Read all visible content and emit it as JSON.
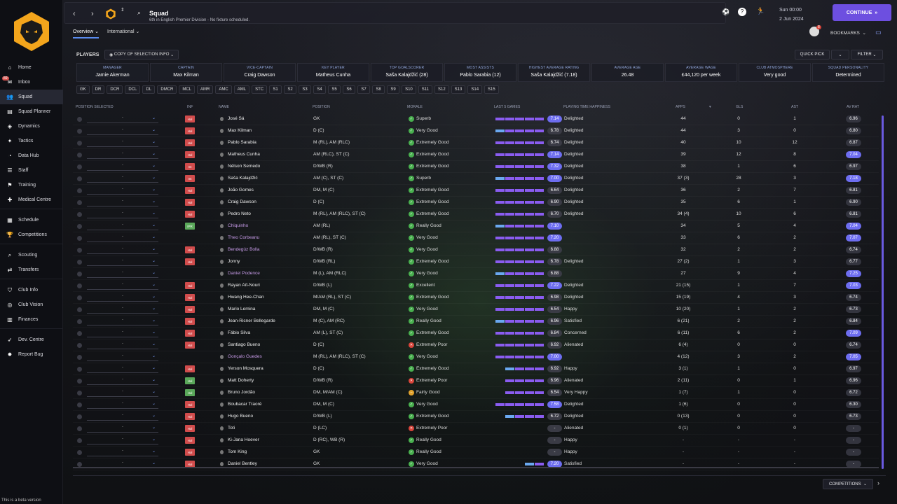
{
  "sidebar": {
    "items": [
      {
        "label": "Home",
        "icon": "home-icon"
      },
      {
        "label": "Inbox",
        "icon": "inbox-icon",
        "badge": "89"
      },
      {
        "label": "Squad",
        "icon": "squad-icon",
        "active": true
      },
      {
        "label": "Squad Planner",
        "icon": "planner-icon"
      },
      {
        "label": "Dynamics",
        "icon": "dynamics-icon"
      },
      {
        "label": "Tactics",
        "icon": "tactics-icon"
      },
      {
        "label": "Data Hub",
        "icon": "datahub-icon"
      },
      {
        "label": "Staff",
        "icon": "staff-icon"
      },
      {
        "label": "Training",
        "icon": "training-icon"
      },
      {
        "label": "Medical Centre",
        "icon": "medical-icon"
      },
      {
        "label": "Schedule",
        "icon": "schedule-icon"
      },
      {
        "label": "Competitions",
        "icon": "trophy-icon"
      },
      {
        "label": "Scouting",
        "icon": "scouting-icon"
      },
      {
        "label": "Transfers",
        "icon": "transfers-icon"
      },
      {
        "label": "Club Info",
        "icon": "club-info-icon"
      },
      {
        "label": "Club Vision",
        "icon": "club-vision-icon"
      },
      {
        "label": "Finances",
        "icon": "finances-icon"
      },
      {
        "label": "Dev. Centre",
        "icon": "dev-centre-icon"
      },
      {
        "label": "Report Bug",
        "icon": "report-bug-icon"
      }
    ],
    "beta_text": "This is a beta version"
  },
  "header": {
    "title": "Squad",
    "subtitle": "6th in English Premier Division - No fixture scheduled.",
    "time": "Sun 00:00",
    "date": "2 Jun 2024",
    "continue_label": "CONTINUE",
    "tabs": [
      "Overview",
      "International"
    ],
    "bookmarks_label": "BOOKMARKS",
    "notif_count": "8"
  },
  "toolbar": {
    "players_label": "PLAYERS",
    "copy_selection": "COPY OF SELECTION INFO",
    "quick_pick": "QUICK PICK",
    "filter": "FILTER"
  },
  "stats": [
    {
      "label": "MANAGER",
      "value": "Jamie Akerman"
    },
    {
      "label": "CAPTAIN",
      "value": "Max Kilman"
    },
    {
      "label": "VICE-CAPTAIN",
      "value": "Craig Dawson"
    },
    {
      "label": "KEY PLAYER",
      "value": "Matheus Cunha"
    },
    {
      "label": "TOP GOALSCORER",
      "value": "Saša Kalajdžić (28)"
    },
    {
      "label": "MOST ASSISTS",
      "value": "Pablo Sarabia (12)"
    },
    {
      "label": "HIGHEST AVERAGE RATING",
      "value": "Saša Kalajdžić (7.18)"
    },
    {
      "label": "AVERAGE AGE",
      "value": "26.48"
    },
    {
      "label": "AVERAGE WAGE",
      "value": "£44,120 per week"
    },
    {
      "label": "CLUB ATMOSPHERE",
      "value": "Very good"
    },
    {
      "label": "SQUAD PERSONALITY",
      "value": "Determined"
    }
  ],
  "position_filters": [
    "GK",
    "DR",
    "DCR",
    "DCL",
    "DL",
    "DMCR",
    "MCL",
    "AMR",
    "AMC",
    "AML",
    "STC",
    "S1",
    "S2",
    "S3",
    "S4",
    "S5",
    "S6",
    "S7",
    "S8",
    "S9",
    "S10",
    "S11",
    "S12",
    "S13",
    "S14",
    "S15"
  ],
  "columns": {
    "pos_selected": "POSITION SELECTED",
    "inf": "INF",
    "name": "NAME",
    "position": "POSITION",
    "morale": "MORALE",
    "last5": "LAST 5 GAMES",
    "pth": "PLAYING TIME HAPPINESS",
    "apps": "APPS",
    "gls": "GLS",
    "ast": "AST",
    "avrat": "AV RAT"
  },
  "players": [
    {
      "inf": "Hol",
      "name": "José Sá",
      "pos": "GK",
      "morale": "Superb",
      "mc": "good",
      "form": 5,
      "rating": "7.14",
      "rhi": true,
      "pth": "Delighted",
      "apps": "44",
      "gls": "0",
      "ast": "1",
      "avr": "6.96",
      "ahi": false
    },
    {
      "inf": "Hol",
      "name": "Max Kilman",
      "pos": "D (C)",
      "morale": "Very Good",
      "mc": "good",
      "form": 5,
      "rating": "6.78",
      "rhi": false,
      "pth": "Delighted",
      "apps": "44",
      "gls": "3",
      "ast": "0",
      "avr": "6.80",
      "ahi": false
    },
    {
      "inf": "Hol",
      "name": "Pablo Sarabia",
      "pos": "M (RL), AM (RLC)",
      "morale": "Extremely Good",
      "mc": "good",
      "form": 5,
      "rating": "6.74",
      "rhi": false,
      "pth": "Delighted",
      "apps": "40",
      "gls": "10",
      "ast": "12",
      "avr": "6.87",
      "ahi": false
    },
    {
      "inf": "Hol",
      "name": "Matheus Cunha",
      "pos": "AM (RLC), ST (C)",
      "morale": "Extremely Good",
      "mc": "good",
      "form": 5,
      "rating": "7.14",
      "rhi": true,
      "pth": "Delighted",
      "apps": "39",
      "gls": "12",
      "ast": "8",
      "avr": "7.04",
      "ahi": true
    },
    {
      "inf": "Int",
      "name": "Nélson Semedo",
      "pos": "D/WB (R)",
      "morale": "Extremely Good",
      "mc": "good",
      "form": 5,
      "rating": "7.32",
      "rhi": true,
      "pth": "Delighted",
      "apps": "38",
      "gls": "1",
      "ast": "6",
      "avr": "6.97",
      "ahi": false
    },
    {
      "inf": "Int",
      "name": "Saša Kalajdžić",
      "pos": "AM (C), ST (C)",
      "morale": "Superb",
      "mc": "good",
      "form": 5,
      "rating": "7.00",
      "rhi": true,
      "pth": "Delighted",
      "apps": "37 (3)",
      "gls": "28",
      "ast": "3",
      "avr": "7.18",
      "ahi": true
    },
    {
      "inf": "Hol",
      "name": "João Gomes",
      "pos": "DM, M (C)",
      "morale": "Extremely Good",
      "mc": "good",
      "form": 5,
      "rating": "6.64",
      "rhi": false,
      "pth": "Delighted",
      "apps": "36",
      "gls": "2",
      "ast": "7",
      "avr": "6.81",
      "ahi": false
    },
    {
      "inf": "Hol",
      "name": "Craig Dawson",
      "pos": "D (C)",
      "morale": "Extremely Good",
      "mc": "good",
      "form": 5,
      "rating": "6.90",
      "rhi": false,
      "pth": "Delighted",
      "apps": "35",
      "gls": "6",
      "ast": "1",
      "avr": "6.90",
      "ahi": false
    },
    {
      "inf": "Hol",
      "name": "Pedro Neto",
      "pos": "M (RL), AM (RLC), ST (C)",
      "morale": "Extremely Good",
      "mc": "good",
      "form": 5,
      "rating": "6.70",
      "rhi": false,
      "pth": "Delighted",
      "apps": "34 (4)",
      "gls": "10",
      "ast": "6",
      "avr": "6.81",
      "ahi": false
    },
    {
      "inf": "IPR",
      "name": "Chiquinho",
      "pos": "AM (RL)",
      "morale": "Really Good",
      "mc": "good",
      "form": 5,
      "rating": "7.10",
      "rhi": true,
      "pth": "",
      "apps": "34",
      "gls": "5",
      "ast": "4",
      "avr": "7.04",
      "ahi": true,
      "loan": true,
      "green": true
    },
    {
      "inf": "",
      "name": "Theo Corbeanu",
      "pos": "AM (RL), ST (C)",
      "morale": "Very Good",
      "mc": "good",
      "form": 5,
      "rating": "7.20",
      "rhi": true,
      "pth": "",
      "apps": "33",
      "gls": "6",
      "ast": "2",
      "avr": "7.07",
      "ahi": true,
      "loan": true
    },
    {
      "inf": "Hol",
      "name": "Bendegúz Bolla",
      "pos": "D/WB (R)",
      "morale": "Very Good",
      "mc": "good",
      "form": 5,
      "rating": "6.88",
      "rhi": false,
      "pth": "",
      "apps": "32",
      "gls": "2",
      "ast": "2",
      "avr": "6.74",
      "ahi": false,
      "loan": true
    },
    {
      "inf": "Hol",
      "name": "Jonny",
      "pos": "D/WB (RL)",
      "morale": "Extremely Good",
      "mc": "good",
      "form": 5,
      "rating": "6.78",
      "rhi": false,
      "pth": "Delighted",
      "apps": "27 (2)",
      "gls": "1",
      "ast": "3",
      "avr": "6.77",
      "ahi": false
    },
    {
      "inf": "",
      "name": "Daniel Podence",
      "pos": "M (L), AM (RLC)",
      "morale": "Very Good",
      "mc": "good",
      "form": 5,
      "rating": "6.88",
      "rhi": false,
      "pth": "",
      "apps": "27",
      "gls": "9",
      "ast": "4",
      "avr": "7.25",
      "ahi": true,
      "loan": true
    },
    {
      "inf": "Hol",
      "name": "Rayan Aït-Nouri",
      "pos": "D/WB (L)",
      "morale": "Excellent",
      "mc": "good",
      "form": 5,
      "rating": "7.22",
      "rhi": true,
      "pth": "Delighted",
      "apps": "21 (15)",
      "gls": "1",
      "ast": "7",
      "avr": "7.03",
      "ahi": true
    },
    {
      "inf": "Hol",
      "name": "Hwang Hee-Chan",
      "pos": "M/AM (RL), ST (C)",
      "morale": "Extremely Good",
      "mc": "good",
      "form": 5,
      "rating": "6.98",
      "rhi": false,
      "pth": "Delighted",
      "apps": "15 (19)",
      "gls": "4",
      "ast": "3",
      "avr": "6.74",
      "ahi": false
    },
    {
      "inf": "Hol",
      "name": "Mario Lemina",
      "pos": "DM, M (C)",
      "morale": "Very Good",
      "mc": "good",
      "form": 5,
      "rating": "6.54",
      "rhi": false,
      "pth": "Happy",
      "apps": "10 (20)",
      "gls": "1",
      "ast": "2",
      "avr": "6.73",
      "ahi": false
    },
    {
      "inf": "Hol",
      "name": "Jean-Ricner Bellegarde",
      "pos": "M (C), AM (RC)",
      "morale": "Really Good",
      "mc": "good",
      "form": 5,
      "rating": "6.96",
      "rhi": false,
      "pth": "Satisfied",
      "apps": "6 (21)",
      "gls": "2",
      "ast": "2",
      "avr": "6.84",
      "ahi": false
    },
    {
      "inf": "Hol",
      "name": "Fábio Silva",
      "pos": "AM (L), ST (C)",
      "morale": "Extremely Good",
      "mc": "good",
      "form": 5,
      "rating": "6.84",
      "rhi": false,
      "pth": "Concerned",
      "apps": "6 (11)",
      "gls": "6",
      "ast": "2",
      "avr": "7.09",
      "ahi": true
    },
    {
      "inf": "Hol",
      "name": "Santiago Bueno",
      "pos": "D (C)",
      "morale": "Extremely Poor",
      "mc": "bad",
      "form": 5,
      "rating": "6.92",
      "rhi": false,
      "pth": "Alienated",
      "apps": "6 (4)",
      "gls": "0",
      "ast": "0",
      "avr": "6.74",
      "ahi": false
    },
    {
      "inf": "",
      "name": "Gonçalo Guedes",
      "pos": "M (RL), AM (RLC), ST (C)",
      "morale": "Very Good",
      "mc": "good",
      "form": 5,
      "rating": "7.00",
      "rhi": true,
      "pth": "",
      "apps": "4 (12)",
      "gls": "3",
      "ast": "2",
      "avr": "7.05",
      "ahi": true,
      "loan": true
    },
    {
      "inf": "Hol",
      "name": "Yerson Mosquera",
      "pos": "D (C)",
      "morale": "Extremely Good",
      "mc": "good",
      "form": 4,
      "rating": "6.92",
      "rhi": false,
      "pth": "Happy",
      "apps": "3 (1)",
      "gls": "1",
      "ast": "0",
      "avr": "6.97",
      "ahi": false
    },
    {
      "inf": "Hol",
      "name": "Matt Doherty",
      "pos": "D/WB (R)",
      "morale": "Extremely Poor",
      "mc": "bad",
      "form": 4,
      "rating": "6.96",
      "rhi": false,
      "pth": "Alienated",
      "apps": "2 (11)",
      "gls": "0",
      "ast": "1",
      "avr": "6.96",
      "ahi": false,
      "green": true
    },
    {
      "inf": "Hol",
      "name": "Bruno Jordão",
      "pos": "DM, M/AM (C)",
      "morale": "Fairly Good",
      "mc": "fair",
      "form": 4,
      "rating": "6.54",
      "rhi": false,
      "pth": "Very Happy",
      "apps": "1 (7)",
      "gls": "1",
      "ast": "0",
      "avr": "6.72",
      "ahi": false,
      "green": true
    },
    {
      "inf": "Hol",
      "name": "Boubacar Traoré",
      "pos": "DM, M (C)",
      "morale": "Very Good",
      "mc": "good",
      "form": 5,
      "rating": "7.58",
      "rhi": true,
      "pth": "Delighted",
      "apps": "1 (6)",
      "gls": "0",
      "ast": "0",
      "avr": "6.30",
      "ahi": false
    },
    {
      "inf": "Hol",
      "name": "Hugo Bueno",
      "pos": "D/WB (L)",
      "morale": "Extremely Good",
      "mc": "good",
      "form": 4,
      "rating": "6.72",
      "rhi": false,
      "pth": "Delighted",
      "apps": "0 (13)",
      "gls": "0",
      "ast": "0",
      "avr": "6.73",
      "ahi": false
    },
    {
      "inf": "Hol",
      "name": "Toti",
      "pos": "D (LC)",
      "morale": "Extremely Poor",
      "mc": "bad",
      "form": 0,
      "rating": "-",
      "rhi": false,
      "pth": "Alienated",
      "apps": "0 (1)",
      "gls": "0",
      "ast": "0",
      "avr": "-",
      "ahi": false
    },
    {
      "inf": "Hol",
      "name": "Ki-Jana Hoever",
      "pos": "D (RC), WB (R)",
      "morale": "Really Good",
      "mc": "good",
      "form": 0,
      "rating": "-",
      "rhi": false,
      "pth": "Happy",
      "apps": "-",
      "gls": "-",
      "ast": "-",
      "avr": "-",
      "ahi": false
    },
    {
      "inf": "Hol",
      "name": "Tom King",
      "pos": "GK",
      "morale": "Really Good",
      "mc": "good",
      "form": 0,
      "rating": "-",
      "rhi": false,
      "pth": "Happy",
      "apps": "-",
      "gls": "-",
      "ast": "-",
      "avr": "-",
      "ahi": false
    },
    {
      "inf": "Hol",
      "name": "Daniel Bentley",
      "pos": "GK",
      "morale": "Very Good",
      "mc": "good",
      "form": 2,
      "rating": "7.20",
      "rhi": true,
      "pth": "Satisfied",
      "apps": "-",
      "gls": "-",
      "ast": "-",
      "avr": "-",
      "ahi": false
    }
  ],
  "footer": {
    "competitions": "COMPETITIONS"
  },
  "colors": {
    "accent": "#6d4fe0",
    "bg": "#0b0c12"
  }
}
